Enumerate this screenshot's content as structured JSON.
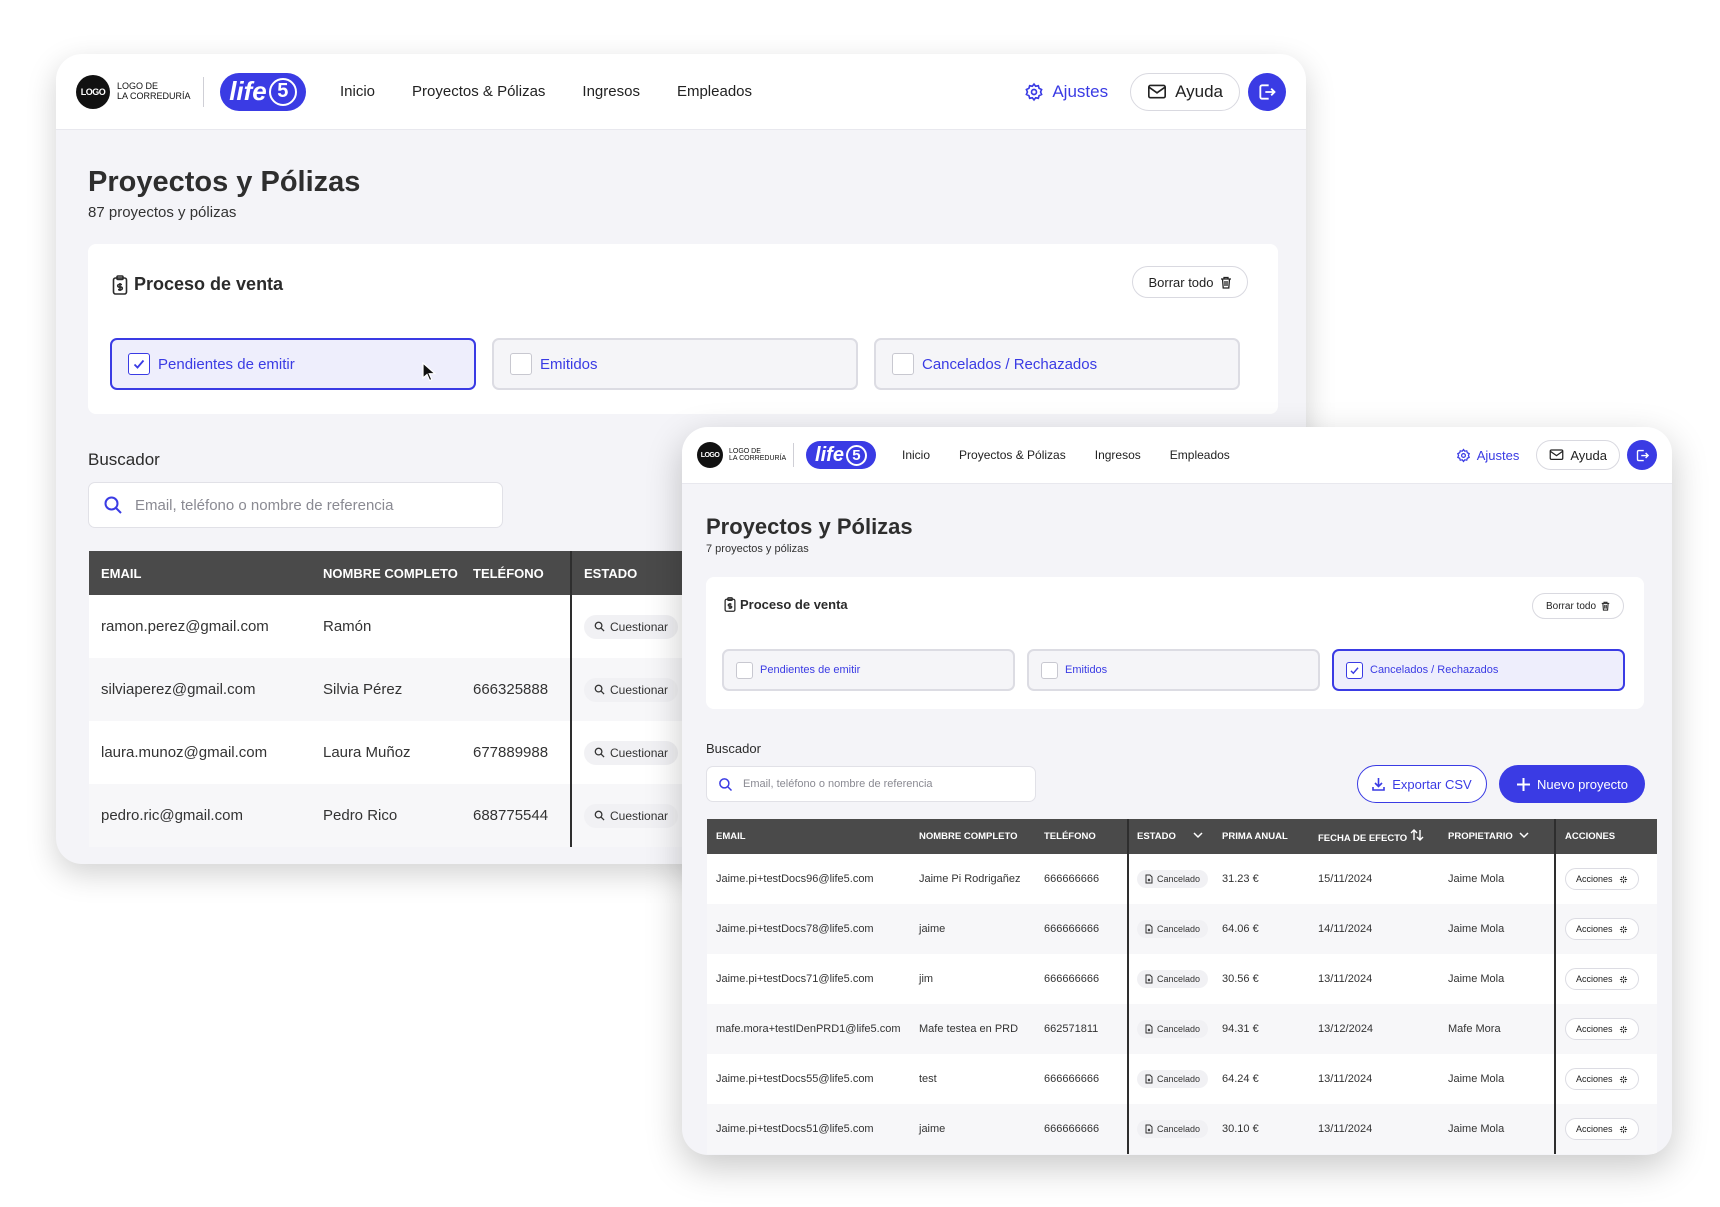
{
  "brand": {
    "logo_badge": "LOGO",
    "logo_text_1": "LOGO DE",
    "logo_text_2": "LA CORREDURÍA",
    "product": "life",
    "product_number": "5"
  },
  "nav": {
    "items": [
      "Inicio",
      "Proyectos & Pólizas",
      "Ingresos",
      "Empleados"
    ],
    "settings": "Ajustes",
    "help": "Ayuda"
  },
  "back": {
    "title": "Proyectos y Pólizas",
    "count": "87 proyectos y pólizas",
    "process_title": "Proceso de venta",
    "clear_all": "Borrar todo",
    "filters": [
      {
        "label": "Pendientes de emitir",
        "checked": true
      },
      {
        "label": "Emitidos",
        "checked": false
      },
      {
        "label": "Cancelados / Rechazados",
        "checked": false
      }
    ],
    "search_label": "Buscador",
    "search_placeholder": "Email, teléfono o nombre de referencia",
    "columns": [
      "EMAIL",
      "NOMBRE COMPLETO",
      "TELÉFONO",
      "ESTADO"
    ],
    "rows": [
      {
        "email": "ramon.perez@gmail.com",
        "name": "Ramón",
        "phone": "",
        "status": "Cuestionar"
      },
      {
        "email": "silviaperez@gmail.com",
        "name": "Silvia Pérez",
        "phone": "666325888",
        "status": "Cuestionar"
      },
      {
        "email": "laura.munoz@gmail.com",
        "name": "Laura Muñoz",
        "phone": "677889988",
        "status": "Cuestionar"
      },
      {
        "email": "pedro.ric@gmail.com",
        "name": "Pedro Rico",
        "phone": "688775544",
        "status": "Cuestionar"
      }
    ]
  },
  "front": {
    "title": "Proyectos y Pólizas",
    "count": "7 proyectos y pólizas",
    "process_title": "Proceso de venta",
    "clear_all": "Borrar todo",
    "filters": [
      {
        "label": "Pendientes de emitir",
        "checked": false
      },
      {
        "label": "Emitidos",
        "checked": false
      },
      {
        "label": "Cancelados / Rechazados",
        "checked": true
      }
    ],
    "search_label": "Buscador",
    "search_placeholder": "Email, teléfono o nombre de referencia",
    "export_csv": "Exportar CSV",
    "new_project": "Nuevo proyecto",
    "columns": [
      "EMAIL",
      "NOMBRE COMPLETO",
      "TELÉFONO",
      "ESTADO",
      "PRIMA ANUAL",
      "FECHA DE EFECTO",
      "PROPIETARIO",
      "ACCIONES"
    ],
    "rows": [
      {
        "email": "Jaime.pi+testDocs96@life5.com",
        "name": "Jaime Pi Rodrigañez",
        "phone": "666666666",
        "status": "Cancelado",
        "premium": "31.23 €",
        "date": "15/11/2024",
        "owner": "Jaime Mola",
        "action": "Acciones"
      },
      {
        "email": "Jaime.pi+testDocs78@life5.com",
        "name": "jaime",
        "phone": "666666666",
        "status": "Cancelado",
        "premium": "64.06 €",
        "date": "14/11/2024",
        "owner": "Jaime Mola",
        "action": "Acciones"
      },
      {
        "email": "Jaime.pi+testDocs71@life5.com",
        "name": "jim",
        "phone": "666666666",
        "status": "Cancelado",
        "premium": "30.56 €",
        "date": "13/11/2024",
        "owner": "Jaime Mola",
        "action": "Acciones"
      },
      {
        "email": "mafe.mora+testIDenPRD1@life5.com",
        "name": "Mafe testea en PRD",
        "phone": "662571811",
        "status": "Cancelado",
        "premium": "94.31 €",
        "date": "13/12/2024",
        "owner": "Mafe Mora",
        "action": "Acciones"
      },
      {
        "email": "Jaime.pi+testDocs55@life5.com",
        "name": "test",
        "phone": "666666666",
        "status": "Cancelado",
        "premium": "64.24 €",
        "date": "13/11/2024",
        "owner": "Jaime Mola",
        "action": "Acciones"
      },
      {
        "email": "Jaime.pi+testDocs51@life5.com",
        "name": "jaime",
        "phone": "666666666",
        "status": "Cancelado",
        "premium": "30.10 €",
        "date": "13/11/2024",
        "owner": "Jaime Mola",
        "action": "Acciones"
      }
    ]
  },
  "colors": {
    "accent": "#3a3be4",
    "header": "#4a4a4a",
    "bg": "#f4f4f8"
  }
}
